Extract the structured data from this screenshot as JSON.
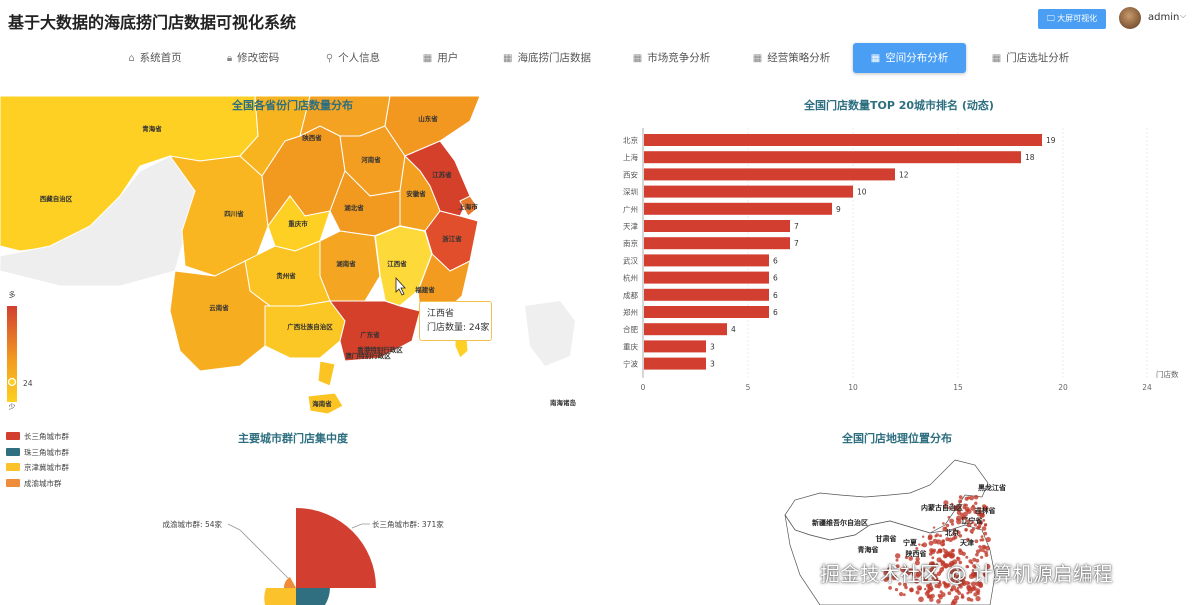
{
  "header": {
    "title": "基于大数据的海底捞门店数据可视化系统",
    "bigscreen_label": "大屏可视化",
    "username": "admin"
  },
  "nav": {
    "items": [
      {
        "label": "系统首页",
        "icon": "home-icon"
      },
      {
        "label": "修改密码",
        "icon": "lock-icon"
      },
      {
        "label": "个人信息",
        "icon": "user-icon"
      },
      {
        "label": "用户",
        "icon": "grid-icon"
      },
      {
        "label": "海底捞门店数据",
        "icon": "grid-icon"
      },
      {
        "label": "市场竞争分析",
        "icon": "grid-icon"
      },
      {
        "label": "经营策略分析",
        "icon": "grid-icon"
      },
      {
        "label": "空间分布分析",
        "icon": "grid-icon",
        "active": true
      },
      {
        "label": "门店选址分析",
        "icon": "grid-icon"
      }
    ]
  },
  "province_map": {
    "title": "全国各省份门店数量分布",
    "visual_map": {
      "high_label": "多",
      "low_label": "少",
      "value_label": "24"
    },
    "provinces": [
      "青海省",
      "西藏自治区",
      "四川省",
      "陕西省",
      "河南省",
      "山东省",
      "江苏省",
      "安徽省",
      "上海市",
      "湖北省",
      "重庆市",
      "浙江省",
      "江西省",
      "湖南省",
      "贵州省",
      "福建省",
      "云南省",
      "广西壮族自治区",
      "广东省",
      "香港特别行政区",
      "澳门特别行政区",
      "海南省",
      "南海诸岛"
    ],
    "tooltip": {
      "name": "江西省",
      "value_text": "门店数量: 24家"
    },
    "colors": {
      "low": "#fdd023",
      "mid": "#f4a021",
      "high": "#d5402b",
      "none": "#e8e8e8"
    }
  },
  "city_chart": {
    "title": "全国门店数量TOP 20城市排名 (动态)",
    "x_axis_label": "门店数",
    "x_ticks": [
      0,
      5,
      10,
      15,
      20,
      24
    ],
    "bar_color": "#d23f31"
  },
  "chart_data": {
    "type": "bar",
    "orientation": "horizontal",
    "categories": [
      "北京",
      "上海",
      "西安",
      "深圳",
      "广州",
      "天津",
      "南京",
      "武汉",
      "杭州",
      "成都",
      "郑州",
      "合肥",
      "重庆",
      "宁波"
    ],
    "values": [
      19,
      18,
      12,
      10,
      9,
      7,
      7,
      6,
      6,
      6,
      6,
      4,
      3,
      3
    ],
    "xlabel": "门店数",
    "xlim": [
      0,
      24
    ]
  },
  "cluster_chart": {
    "title": "主要城市群门店集中度",
    "legend": [
      {
        "name": "长三角城市群",
        "color": "#d23f31"
      },
      {
        "name": "珠三角城市群",
        "color": "#2f6f7f"
      },
      {
        "name": "京津冀城市群",
        "color": "#fcc22b"
      },
      {
        "name": "成渝城市群",
        "color": "#ef8c3a"
      }
    ],
    "labels": [
      {
        "text": "长三角城市群: 371家",
        "value": 371
      },
      {
        "text": "成渝城市群: 54家",
        "value": 54
      }
    ]
  },
  "geo_chart": {
    "title": "全国门店地理位置分布",
    "labels": [
      "黑龙江省",
      "内蒙古自治区",
      "吉林省",
      "辽宁省",
      "新疆维吾尔自治区",
      "甘肃省",
      "青海省",
      "宁夏",
      "陕西省",
      "北京",
      "天津"
    ]
  },
  "watermark": "掘金技术社区 @ 计算机源启编程"
}
